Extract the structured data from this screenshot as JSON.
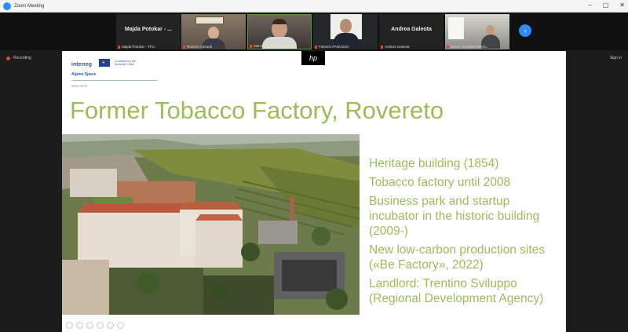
{
  "window": {
    "title": "Zoom Meeting",
    "controls": [
      "–",
      "▢",
      "✕"
    ]
  },
  "participants": [
    {
      "display": "Majda Potokar - ...",
      "label": "Majda Potokar - TPLI",
      "has_video": false
    },
    {
      "display": "",
      "label": "Roberto Gerardi",
      "has_video": true
    },
    {
      "display": "",
      "label": "Marcello Ghiselli",
      "has_video": true
    },
    {
      "display": "",
      "label": "Fabrizio PANOZZO",
      "has_video": true
    },
    {
      "display": "Andrea Galeota",
      "label": "Andrea Galeota",
      "has_video": false
    },
    {
      "display": "",
      "label": "Simon Gmainer (WKO...",
      "has_video": true
    }
  ],
  "status": {
    "recording": "Recording",
    "signin": "Sign in"
  },
  "slide": {
    "hp_logo": "hp",
    "logo": {
      "interreg": "interreg",
      "eu_text": "Co-funded by the European Union",
      "program": "Alpine Space",
      "project": "RESILIENTE"
    },
    "title": "Former Tobacco Factory, Rovereto",
    "bullets": [
      "Heritage building (1854)",
      "Tobacco factory until 2008",
      "Business park and startup incubator in the historic building (2009-)",
      "New low-carbon production sites («Be Factory», 2022)",
      "Landlord: Trentino Sviluppo (Regional Development Agency)"
    ]
  },
  "colors": {
    "accent_green": "#9cbc5a",
    "zoom_blue": "#2d8cff",
    "mic_red": "#e0453a"
  }
}
